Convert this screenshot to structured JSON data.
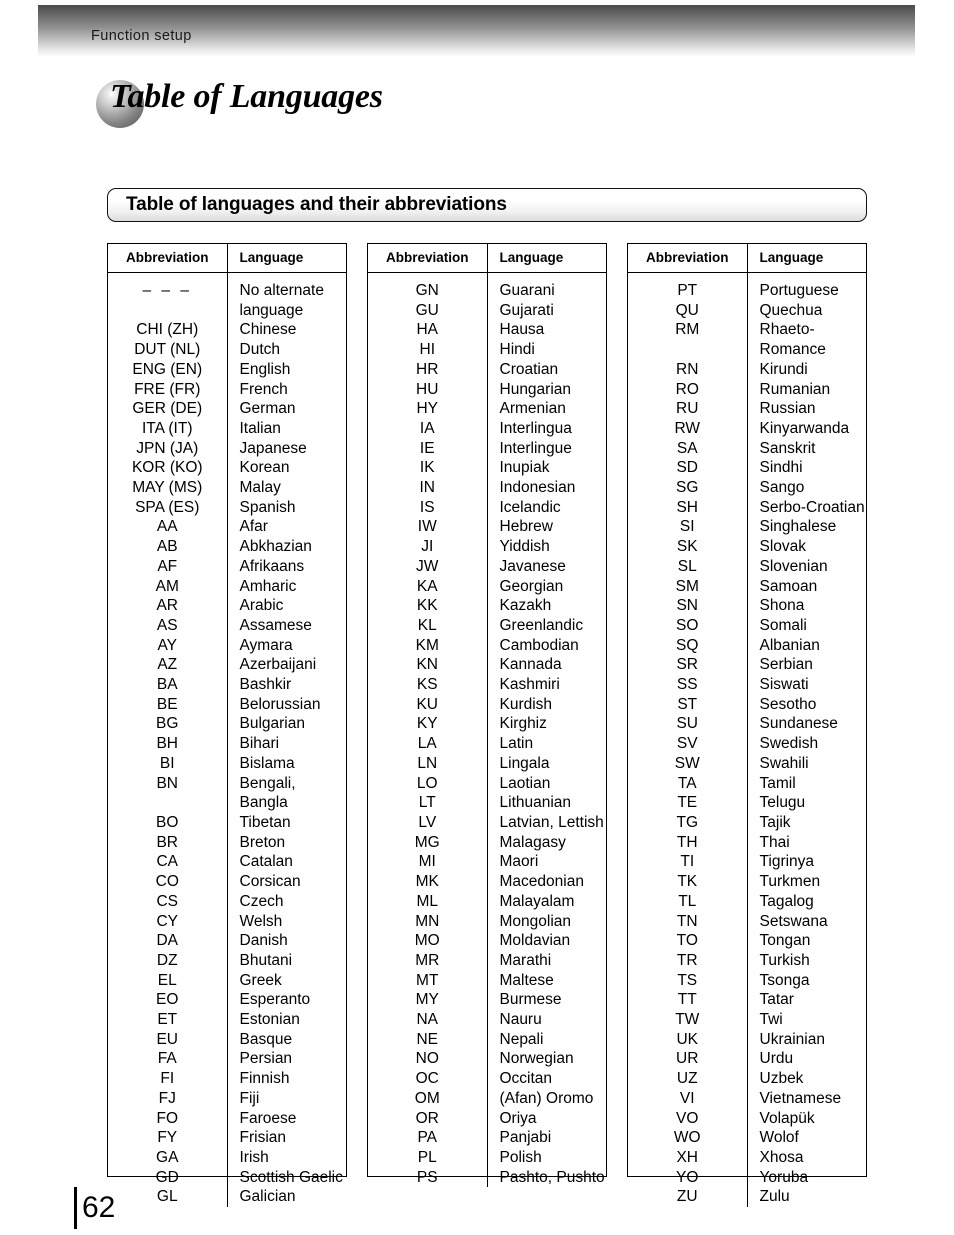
{
  "header": {
    "running_head": "Function setup"
  },
  "title": {
    "text": "Table of Languages",
    "bullet_icon": "sphere-icon"
  },
  "subtitle": {
    "text": "Table of languages and their abbreviations"
  },
  "table_columns": {
    "abbreviation": "Abbreviation",
    "language": "Language"
  },
  "tables": [
    {
      "rows": [
        {
          "abbr": "– – –",
          "lang": "No alternate\nlanguage"
        },
        {
          "abbr": "CHI (ZH)",
          "lang": "Chinese"
        },
        {
          "abbr": "DUT (NL)",
          "lang": "Dutch"
        },
        {
          "abbr": "ENG (EN)",
          "lang": "English"
        },
        {
          "abbr": "FRE (FR)",
          "lang": "French"
        },
        {
          "abbr": "GER (DE)",
          "lang": "German"
        },
        {
          "abbr": "ITA (IT)",
          "lang": "Italian"
        },
        {
          "abbr": "JPN (JA)",
          "lang": "Japanese"
        },
        {
          "abbr": "KOR (KO)",
          "lang": "Korean"
        },
        {
          "abbr": "MAY (MS)",
          "lang": "Malay"
        },
        {
          "abbr": "SPA (ES)",
          "lang": "Spanish"
        },
        {
          "abbr": "AA",
          "lang": "Afar"
        },
        {
          "abbr": "AB",
          "lang": "Abkhazian"
        },
        {
          "abbr": "AF",
          "lang": "Afrikaans"
        },
        {
          "abbr": "AM",
          "lang": "Amharic"
        },
        {
          "abbr": "AR",
          "lang": "Arabic"
        },
        {
          "abbr": "AS",
          "lang": "Assamese"
        },
        {
          "abbr": "AY",
          "lang": "Aymara"
        },
        {
          "abbr": "AZ",
          "lang": "Azerbaijani"
        },
        {
          "abbr": "BA",
          "lang": "Bashkir"
        },
        {
          "abbr": "BE",
          "lang": "Belorussian"
        },
        {
          "abbr": "BG",
          "lang": "Bulgarian"
        },
        {
          "abbr": "BH",
          "lang": "Bihari"
        },
        {
          "abbr": "BI",
          "lang": "Bislama"
        },
        {
          "abbr": "BN",
          "lang": "Bengali, Bangla"
        },
        {
          "abbr": "BO",
          "lang": "Tibetan"
        },
        {
          "abbr": "BR",
          "lang": "Breton"
        },
        {
          "abbr": "CA",
          "lang": "Catalan"
        },
        {
          "abbr": "CO",
          "lang": "Corsican"
        },
        {
          "abbr": "CS",
          "lang": "Czech"
        },
        {
          "abbr": "CY",
          "lang": "Welsh"
        },
        {
          "abbr": "DA",
          "lang": "Danish"
        },
        {
          "abbr": "DZ",
          "lang": "Bhutani"
        },
        {
          "abbr": "EL",
          "lang": "Greek"
        },
        {
          "abbr": "EO",
          "lang": "Esperanto"
        },
        {
          "abbr": "ET",
          "lang": "Estonian"
        },
        {
          "abbr": "EU",
          "lang": "Basque"
        },
        {
          "abbr": "FA",
          "lang": "Persian"
        },
        {
          "abbr": "FI",
          "lang": "Finnish"
        },
        {
          "abbr": "FJ",
          "lang": "Fiji"
        },
        {
          "abbr": "FO",
          "lang": "Faroese"
        },
        {
          "abbr": "FY",
          "lang": "Frisian"
        },
        {
          "abbr": "GA",
          "lang": "Irish"
        },
        {
          "abbr": "GD",
          "lang": "Scottish Gaelic"
        },
        {
          "abbr": "GL",
          "lang": "Galician"
        }
      ]
    },
    {
      "rows": [
        {
          "abbr": "GN",
          "lang": "Guarani"
        },
        {
          "abbr": "GU",
          "lang": "Gujarati"
        },
        {
          "abbr": "HA",
          "lang": "Hausa"
        },
        {
          "abbr": "HI",
          "lang": "Hindi"
        },
        {
          "abbr": "HR",
          "lang": "Croatian"
        },
        {
          "abbr": "HU",
          "lang": "Hungarian"
        },
        {
          "abbr": "HY",
          "lang": "Armenian"
        },
        {
          "abbr": "IA",
          "lang": "Interlingua"
        },
        {
          "abbr": "IE",
          "lang": "Interlingue"
        },
        {
          "abbr": "IK",
          "lang": "Inupiak"
        },
        {
          "abbr": "IN",
          "lang": "Indonesian"
        },
        {
          "abbr": "IS",
          "lang": "Icelandic"
        },
        {
          "abbr": "IW",
          "lang": "Hebrew"
        },
        {
          "abbr": "JI",
          "lang": "Yiddish"
        },
        {
          "abbr": "JW",
          "lang": "Javanese"
        },
        {
          "abbr": "KA",
          "lang": "Georgian"
        },
        {
          "abbr": "KK",
          "lang": "Kazakh"
        },
        {
          "abbr": "KL",
          "lang": "Greenlandic"
        },
        {
          "abbr": "KM",
          "lang": "Cambodian"
        },
        {
          "abbr": "KN",
          "lang": "Kannada"
        },
        {
          "abbr": "KS",
          "lang": "Kashmiri"
        },
        {
          "abbr": "KU",
          "lang": "Kurdish"
        },
        {
          "abbr": "KY",
          "lang": "Kirghiz"
        },
        {
          "abbr": "LA",
          "lang": "Latin"
        },
        {
          "abbr": "LN",
          "lang": "Lingala"
        },
        {
          "abbr": "LO",
          "lang": "Laotian"
        },
        {
          "abbr": "LT",
          "lang": "Lithuanian"
        },
        {
          "abbr": "LV",
          "lang": "Latvian, Lettish"
        },
        {
          "abbr": "MG",
          "lang": "Malagasy"
        },
        {
          "abbr": "MI",
          "lang": "Maori"
        },
        {
          "abbr": "MK",
          "lang": "Macedonian"
        },
        {
          "abbr": "ML",
          "lang": "Malayalam"
        },
        {
          "abbr": "MN",
          "lang": "Mongolian"
        },
        {
          "abbr": "MO",
          "lang": "Moldavian"
        },
        {
          "abbr": "MR",
          "lang": "Marathi"
        },
        {
          "abbr": "MT",
          "lang": "Maltese"
        },
        {
          "abbr": "MY",
          "lang": "Burmese"
        },
        {
          "abbr": "NA",
          "lang": "Nauru"
        },
        {
          "abbr": "NE",
          "lang": "Nepali"
        },
        {
          "abbr": "NO",
          "lang": "Norwegian"
        },
        {
          "abbr": "OC",
          "lang": "Occitan"
        },
        {
          "abbr": "OM",
          "lang": "(Afan) Oromo"
        },
        {
          "abbr": "OR",
          "lang": "Oriya"
        },
        {
          "abbr": "PA",
          "lang": "Panjabi"
        },
        {
          "abbr": "PL",
          "lang": "Polish"
        },
        {
          "abbr": "PS",
          "lang": "Pashto, Pushto"
        }
      ]
    },
    {
      "rows": [
        {
          "abbr": "PT",
          "lang": "Portuguese"
        },
        {
          "abbr": "QU",
          "lang": "Quechua"
        },
        {
          "abbr": "RM",
          "lang": "Rhaeto-Romance"
        },
        {
          "abbr": "RN",
          "lang": "Kirundi"
        },
        {
          "abbr": "RO",
          "lang": "Rumanian"
        },
        {
          "abbr": "RU",
          "lang": "Russian"
        },
        {
          "abbr": "RW",
          "lang": "Kinyarwanda"
        },
        {
          "abbr": "SA",
          "lang": "Sanskrit"
        },
        {
          "abbr": "SD",
          "lang": "Sindhi"
        },
        {
          "abbr": "SG",
          "lang": "Sango"
        },
        {
          "abbr": "SH",
          "lang": "Serbo-Croatian"
        },
        {
          "abbr": "SI",
          "lang": "Singhalese"
        },
        {
          "abbr": "SK",
          "lang": "Slovak"
        },
        {
          "abbr": "SL",
          "lang": "Slovenian"
        },
        {
          "abbr": "SM",
          "lang": "Samoan"
        },
        {
          "abbr": "SN",
          "lang": "Shona"
        },
        {
          "abbr": "SO",
          "lang": "Somali"
        },
        {
          "abbr": "SQ",
          "lang": "Albanian"
        },
        {
          "abbr": "SR",
          "lang": "Serbian"
        },
        {
          "abbr": "SS",
          "lang": "Siswati"
        },
        {
          "abbr": "ST",
          "lang": "Sesotho"
        },
        {
          "abbr": "SU",
          "lang": "Sundanese"
        },
        {
          "abbr": "SV",
          "lang": "Swedish"
        },
        {
          "abbr": "SW",
          "lang": "Swahili"
        },
        {
          "abbr": "TA",
          "lang": "Tamil"
        },
        {
          "abbr": "TE",
          "lang": "Telugu"
        },
        {
          "abbr": "TG",
          "lang": "Tajik"
        },
        {
          "abbr": "TH",
          "lang": "Thai"
        },
        {
          "abbr": "TI",
          "lang": "Tigrinya"
        },
        {
          "abbr": "TK",
          "lang": "Turkmen"
        },
        {
          "abbr": "TL",
          "lang": "Tagalog"
        },
        {
          "abbr": "TN",
          "lang": "Setswana"
        },
        {
          "abbr": "TO",
          "lang": "Tongan"
        },
        {
          "abbr": "TR",
          "lang": "Turkish"
        },
        {
          "abbr": "TS",
          "lang": "Tsonga"
        },
        {
          "abbr": "TT",
          "lang": "Tatar"
        },
        {
          "abbr": "TW",
          "lang": "Twi"
        },
        {
          "abbr": "UK",
          "lang": "Ukrainian"
        },
        {
          "abbr": "UR",
          "lang": "Urdu"
        },
        {
          "abbr": "UZ",
          "lang": "Uzbek"
        },
        {
          "abbr": "VI",
          "lang": "Vietnamese"
        },
        {
          "abbr": "VO",
          "lang": "Volapük"
        },
        {
          "abbr": "WO",
          "lang": "Wolof"
        },
        {
          "abbr": "XH",
          "lang": "Xhosa"
        },
        {
          "abbr": "YO",
          "lang": "Yoruba"
        },
        {
          "abbr": "ZU",
          "lang": "Zulu"
        }
      ]
    }
  ],
  "footer": {
    "page_number": "62"
  }
}
